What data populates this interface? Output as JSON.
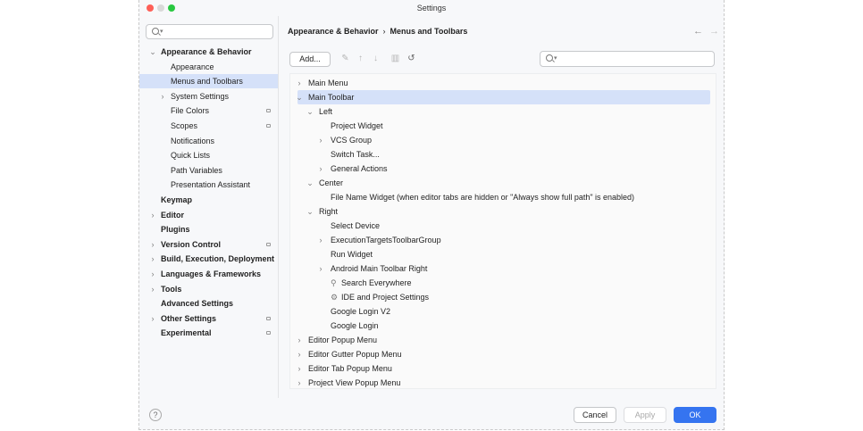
{
  "window": {
    "title": "Settings"
  },
  "sidebar": {
    "search_placeholder": "",
    "items": [
      {
        "label": "Appearance & Behavior",
        "bold": true,
        "chevron": "expanded",
        "indent": 0
      },
      {
        "label": "Appearance",
        "bold": false,
        "chevron": "none",
        "indent": 1
      },
      {
        "label": "Menus and Toolbars",
        "bold": false,
        "chevron": "none",
        "indent": 1,
        "selected": true
      },
      {
        "label": "System Settings",
        "bold": false,
        "chevron": "collapsed",
        "indent": 1
      },
      {
        "label": "File Colors",
        "bold": false,
        "chevron": "none",
        "indent": 1,
        "marker": true
      },
      {
        "label": "Scopes",
        "bold": false,
        "chevron": "none",
        "indent": 1,
        "marker": true
      },
      {
        "label": "Notifications",
        "bold": false,
        "chevron": "none",
        "indent": 1
      },
      {
        "label": "Quick Lists",
        "bold": false,
        "chevron": "none",
        "indent": 1
      },
      {
        "label": "Path Variables",
        "bold": false,
        "chevron": "none",
        "indent": 1
      },
      {
        "label": "Presentation Assistant",
        "bold": false,
        "chevron": "none",
        "indent": 1
      },
      {
        "label": "Keymap",
        "bold": true,
        "chevron": "none",
        "indent": 0
      },
      {
        "label": "Editor",
        "bold": true,
        "chevron": "collapsed",
        "indent": 0
      },
      {
        "label": "Plugins",
        "bold": true,
        "chevron": "none",
        "indent": 0
      },
      {
        "label": "Version Control",
        "bold": true,
        "chevron": "collapsed",
        "indent": 0,
        "marker": true
      },
      {
        "label": "Build, Execution, Deployment",
        "bold": true,
        "chevron": "collapsed",
        "indent": 0
      },
      {
        "label": "Languages & Frameworks",
        "bold": true,
        "chevron": "collapsed",
        "indent": 0
      },
      {
        "label": "Tools",
        "bold": true,
        "chevron": "collapsed",
        "indent": 0
      },
      {
        "label": "Advanced Settings",
        "bold": true,
        "chevron": "none",
        "indent": 0
      },
      {
        "label": "Other Settings",
        "bold": true,
        "chevron": "collapsed",
        "indent": 0,
        "marker": true
      },
      {
        "label": "Experimental",
        "bold": true,
        "chevron": "none",
        "indent": 0,
        "marker": true
      }
    ]
  },
  "content": {
    "breadcrumb": {
      "parent": "Appearance & Behavior",
      "separator": "›",
      "current": "Menus and Toolbars"
    },
    "nav": {
      "back": "←",
      "forward": "→"
    },
    "toolbar": {
      "add_label": "Add...",
      "icons": [
        "edit-icon",
        "move-up-icon",
        "move-down-icon",
        "delete-icon",
        "restore-icon"
      ]
    },
    "search_placeholder": "",
    "tree": [
      {
        "label": "Main Menu",
        "depth": 0,
        "chevron": "collapsed"
      },
      {
        "label": "Main Toolbar",
        "depth": 0,
        "chevron": "expanded",
        "selected": true
      },
      {
        "label": "Left",
        "depth": 1,
        "chevron": "expanded"
      },
      {
        "label": "Project Widget",
        "depth": 2,
        "chevron": "none"
      },
      {
        "label": "VCS Group",
        "depth": 2,
        "chevron": "collapsed"
      },
      {
        "label": "Switch Task...",
        "depth": 2,
        "chevron": "none"
      },
      {
        "label": "General Actions",
        "depth": 2,
        "chevron": "collapsed"
      },
      {
        "label": "Center",
        "depth": 1,
        "chevron": "expanded"
      },
      {
        "label": "File Name Widget (when editor tabs are hidden or \"Always show full path\" is enabled)",
        "depth": 2,
        "chevron": "none"
      },
      {
        "label": "Right",
        "depth": 1,
        "chevron": "expanded"
      },
      {
        "label": "Select Device",
        "depth": 2,
        "chevron": "none"
      },
      {
        "label": "ExecutionTargetsToolbarGroup",
        "depth": 2,
        "chevron": "collapsed"
      },
      {
        "label": "Run Widget",
        "depth": 2,
        "chevron": "none"
      },
      {
        "label": "Android Main Toolbar Right",
        "depth": 2,
        "chevron": "collapsed"
      },
      {
        "label": "Search Everywhere",
        "depth": 2,
        "chevron": "none",
        "icon": "search-icon"
      },
      {
        "label": "IDE and Project Settings",
        "depth": 2,
        "chevron": "none",
        "icon": "gear-icon"
      },
      {
        "label": "Google Login V2",
        "depth": 2,
        "chevron": "none"
      },
      {
        "label": "Google Login",
        "depth": 2,
        "chevron": "none"
      },
      {
        "label": "Editor Popup Menu",
        "depth": 0,
        "chevron": "collapsed"
      },
      {
        "label": "Editor Gutter Popup Menu",
        "depth": 0,
        "chevron": "collapsed"
      },
      {
        "label": "Editor Tab Popup Menu",
        "depth": 0,
        "chevron": "collapsed"
      },
      {
        "label": "Project View Popup Menu",
        "depth": 0,
        "chevron": "collapsed"
      }
    ]
  },
  "footer": {
    "help": "?",
    "cancel": "Cancel",
    "apply": "Apply",
    "ok": "OK"
  },
  "colors": {
    "selection": "#d5e1f9",
    "accent": "#3574f0",
    "window_bg": "#f7f8fa"
  }
}
